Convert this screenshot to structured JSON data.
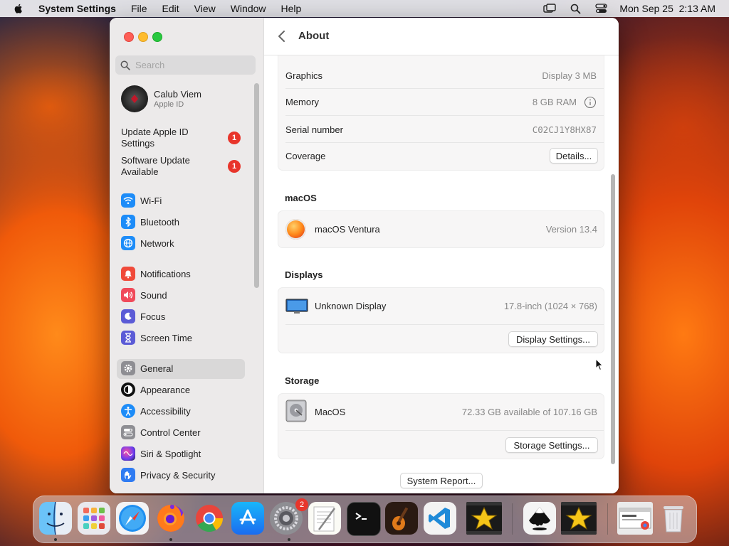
{
  "menubar": {
    "app_name": "System Settings",
    "menus": [
      "File",
      "Edit",
      "View",
      "Window",
      "Help"
    ],
    "clock": "Mon Sep 25  2:13 AM",
    "status_icons": [
      "screen-mirroring-icon",
      "search-icon",
      "control-center-icon"
    ]
  },
  "sidebar": {
    "search_placeholder": "Search",
    "profile": {
      "name": "Calub Viem",
      "subtitle": "Apple ID"
    },
    "alerts": [
      {
        "label": "Update Apple ID Settings",
        "badge": "1"
      },
      {
        "label": "Software Update Available",
        "badge": "1"
      }
    ],
    "items": [
      {
        "label": "Wi-Fi",
        "icon": "wifi-icon",
        "color": "#1d8cf8"
      },
      {
        "label": "Bluetooth",
        "icon": "bluetooth-icon",
        "color": "#1d8cf8"
      },
      {
        "label": "Network",
        "icon": "network-icon",
        "color": "#1d8cf8"
      },
      {
        "label": "Notifications",
        "icon": "notifications-icon",
        "color": "#f04a3a"
      },
      {
        "label": "Sound",
        "icon": "sound-icon",
        "color": "#f04a5a"
      },
      {
        "label": "Focus",
        "icon": "focus-icon",
        "color": "#5b5bd6"
      },
      {
        "label": "Screen Time",
        "icon": "screen-time-icon",
        "color": "#5b5bd6"
      },
      {
        "label": "General",
        "icon": "gear-icon",
        "color": "#8e8e93",
        "selected": true
      },
      {
        "label": "Appearance",
        "icon": "appearance-icon",
        "color": "#111111"
      },
      {
        "label": "Accessibility",
        "icon": "accessibility-icon",
        "color": "#1d8cf8"
      },
      {
        "label": "Control Center",
        "icon": "control-center-icon",
        "color": "#8e8e93"
      },
      {
        "label": "Siri & Spotlight",
        "icon": "siri-icon",
        "color": "#c43bd0"
      },
      {
        "label": "Privacy & Security",
        "icon": "hand-icon",
        "color": "#2f7bf2"
      }
    ]
  },
  "header": {
    "title": "About"
  },
  "hardware": {
    "graphics_label": "Graphics",
    "graphics_value": "Display 3 MB",
    "memory_label": "Memory",
    "memory_value": "8 GB RAM",
    "serial_label": "Serial number",
    "serial_value": "C02CJ1Y8HX87",
    "coverage_label": "Coverage",
    "details_button": "Details..."
  },
  "macos": {
    "section_title": "macOS",
    "name": "macOS Ventura",
    "version": "Version 13.4"
  },
  "displays": {
    "section_title": "Displays",
    "name": "Unknown Display",
    "value": "17.8-inch (1024 × 768)",
    "button": "Display Settings..."
  },
  "storage": {
    "section_title": "Storage",
    "name": "MacOS",
    "value": "72.33 GB available of 107.16 GB",
    "button": "Storage Settings..."
  },
  "system_report_button": "System Report...",
  "dock": {
    "apps": [
      {
        "name": "Finder",
        "icon": "finder-icon",
        "running": true
      },
      {
        "name": "Launchpad",
        "icon": "launchpad-icon",
        "running": false
      },
      {
        "name": "Safari",
        "icon": "safari-icon",
        "running": false
      },
      {
        "name": "Firefox",
        "icon": "firefox-icon",
        "running": true
      },
      {
        "name": "Chrome",
        "icon": "chrome-icon",
        "running": false
      },
      {
        "name": "App Store",
        "icon": "app-store-icon",
        "running": false
      },
      {
        "name": "System Settings",
        "icon": "system-settings-icon",
        "running": true,
        "badge": "2"
      },
      {
        "name": "TextEdit",
        "icon": "textedit-icon",
        "running": false
      },
      {
        "name": "Terminal",
        "icon": "terminal-icon",
        "running": false
      },
      {
        "name": "GarageBand",
        "icon": "garageband-icon",
        "running": false
      },
      {
        "name": "Visual Studio Code",
        "icon": "vscode-icon",
        "running": false
      },
      {
        "name": "iMovie",
        "icon": "star-film-icon",
        "running": false
      },
      {
        "name": "Inkscape",
        "icon": "inkscape-icon",
        "running": false
      },
      {
        "name": "Star Film",
        "icon": "star-film-icon",
        "running": false
      },
      {
        "name": "Chrome Window",
        "icon": "chrome-window-icon",
        "running": false
      },
      {
        "name": "Trash",
        "icon": "trash-icon",
        "running": false
      }
    ]
  }
}
